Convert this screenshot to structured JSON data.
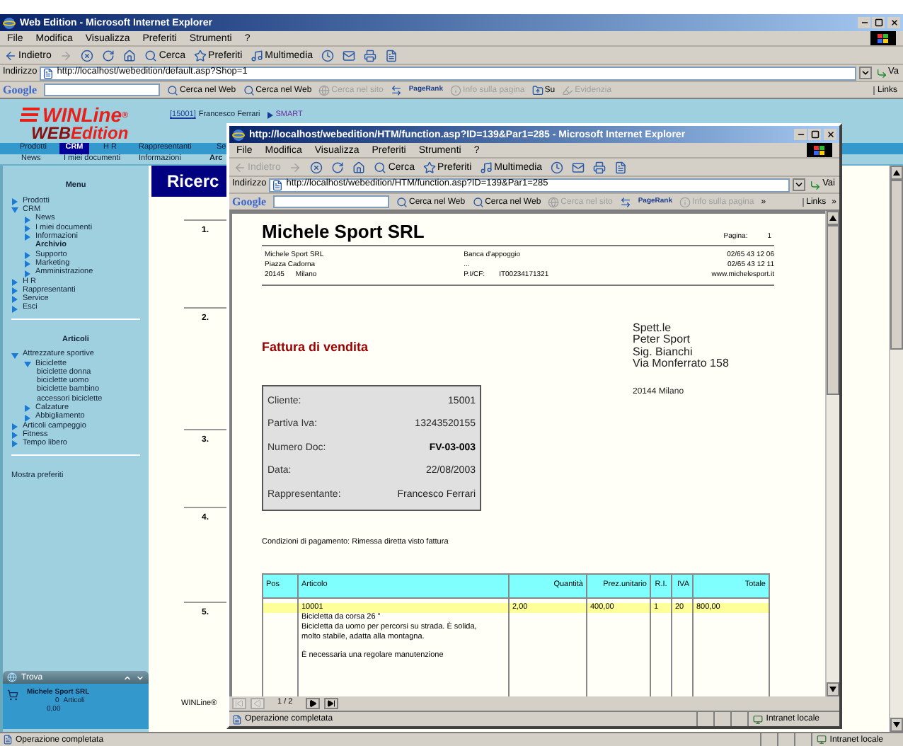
{
  "main": {
    "title": "Web Edition - Microsoft Internet Explorer",
    "menu": [
      "File",
      "Modifica",
      "Visualizza",
      "Preferiti",
      "Strumenti",
      "?"
    ],
    "toolbar": [
      {
        "kind": "back",
        "label": "Indietro",
        "disabled": false
      },
      {
        "kind": "forward",
        "disabled": true
      },
      {
        "kind": "stop",
        "disabled": false
      },
      {
        "kind": "refresh",
        "disabled": false
      },
      {
        "kind": "home",
        "disabled": false
      },
      {
        "kind": "search",
        "label": "Cerca",
        "disabled": false
      },
      {
        "kind": "favorites",
        "label": "Preferiti",
        "disabled": false
      },
      {
        "kind": "media",
        "label": "Multimedia",
        "disabled": false
      },
      {
        "kind": "history",
        "disabled": false
      },
      {
        "kind": "mail",
        "disabled": false
      },
      {
        "kind": "print",
        "disabled": false
      },
      {
        "kind": "edit",
        "disabled": false
      }
    ],
    "address": {
      "label": "Indirizzo",
      "value": "http://localhost/webedition/default.asp?Shop=1",
      "go": "Va"
    },
    "google": {
      "logo": "Google",
      "items": [
        {
          "kind": "search",
          "label": "Cerca nel Web",
          "disabled": false
        },
        {
          "kind": "search",
          "label": "Cerca nel Web",
          "disabled": false
        },
        {
          "kind": "site",
          "label": "Cerca nel sito",
          "disabled": true
        },
        {
          "kind": "arrows",
          "disabled": false
        },
        {
          "kind": "pagerank",
          "label": "PageRank",
          "disabled": false
        },
        {
          "kind": "info",
          "label": "Info sulla pagina",
          "disabled": true
        },
        {
          "kind": "up",
          "label": "Su",
          "disabled": false
        },
        {
          "kind": "highlight",
          "label": "Evidenzia",
          "disabled": true
        }
      ],
      "links": "Links"
    },
    "status": {
      "text": "Operazione completata",
      "zone": "Intranet locale"
    }
  },
  "app": {
    "logo": {
      "name": "WINLine",
      "mark": "®",
      "sub_a": "WEB",
      "sub_b": "Edition"
    },
    "user": {
      "code": "[15001]",
      "name": "Francesco Ferrari",
      "mode": "SMART"
    },
    "nav": [
      {
        "label": "Prodotti",
        "selected": false
      },
      {
        "label": "CRM",
        "selected": true
      },
      {
        "label": "H R",
        "selected": false
      },
      {
        "label": "Rappresentanti",
        "selected": false
      },
      {
        "label": "Se",
        "selected": false
      }
    ],
    "subnav": [
      "News",
      "I miei documenti",
      "Informazioni",
      "Arc"
    ],
    "heading": "Ricerc",
    "menu_title": "Menu",
    "menu": [
      {
        "label": "Prodotti",
        "kind": "node",
        "expanded": false
      },
      {
        "label": "CRM",
        "kind": "node",
        "expanded": true,
        "children": [
          {
            "label": "News",
            "kind": "node",
            "expanded": false
          },
          {
            "label": "I miei documenti",
            "kind": "node",
            "expanded": false
          },
          {
            "label": "Informazioni",
            "kind": "node",
            "expanded": false
          },
          {
            "label": "Archivio",
            "kind": "current"
          },
          {
            "label": "Supporto",
            "kind": "node",
            "expanded": false
          },
          {
            "label": "Marketing",
            "kind": "node",
            "expanded": false
          },
          {
            "label": "Amministrazione",
            "kind": "node",
            "expanded": false
          }
        ]
      },
      {
        "label": "H R",
        "kind": "node",
        "expanded": false
      },
      {
        "label": "Rappresentanti",
        "kind": "node",
        "expanded": false
      },
      {
        "label": "Service",
        "kind": "node",
        "expanded": false
      },
      {
        "label": "Esci",
        "kind": "node",
        "expanded": false
      }
    ],
    "articles_title": "Articoli",
    "articles": [
      {
        "label": "Attrezzature sportive",
        "kind": "node",
        "expanded": true,
        "children": [
          {
            "label": "Biciclette",
            "kind": "node",
            "expanded": true,
            "children": [
              {
                "label": "biciclette donna",
                "kind": "leaf"
              },
              {
                "label": "biciclette uomo",
                "kind": "leaf"
              },
              {
                "label": "biciclette bambino",
                "kind": "leaf"
              },
              {
                "label": "accessori biciclette",
                "kind": "leaf"
              }
            ]
          },
          {
            "label": "Calzature",
            "kind": "node",
            "expanded": false
          },
          {
            "label": "Abbigliamento",
            "kind": "node",
            "expanded": false
          }
        ]
      },
      {
        "label": "Articoli campeggio",
        "kind": "node",
        "expanded": false
      },
      {
        "label": "Fitness",
        "kind": "node",
        "expanded": false
      },
      {
        "label": "Tempo libero",
        "kind": "node",
        "expanded": false
      }
    ],
    "favorites": "Mostra preferiti",
    "rows": [
      "1.",
      "2.",
      "3.",
      "4.",
      "5."
    ],
    "footer": "WINLine®",
    "finder": {
      "title": "Trova",
      "customer": "Michele Sport SRL",
      "count": "0",
      "count_label": "Articoli",
      "amount": "0,00"
    }
  },
  "popup": {
    "title": "http://localhost/webedition/HTM/function.asp?ID=139&Par1=285 - Microsoft Internet Explorer",
    "menu": [
      "File",
      "Modifica",
      "Visualizza",
      "Preferiti",
      "Strumenti",
      "?"
    ],
    "toolbar": [
      {
        "kind": "back",
        "label": "Indietro",
        "disabled": true
      },
      {
        "kind": "forward",
        "disabled": true
      },
      {
        "kind": "stop",
        "disabled": false
      },
      {
        "kind": "refresh",
        "disabled": false
      },
      {
        "kind": "home",
        "disabled": false
      },
      {
        "kind": "search",
        "label": "Cerca",
        "disabled": false
      },
      {
        "kind": "favorites",
        "label": "Preferiti",
        "disabled": false
      },
      {
        "kind": "media",
        "label": "Multimedia",
        "disabled": false
      },
      {
        "kind": "history",
        "disabled": false
      },
      {
        "kind": "mail",
        "disabled": false
      },
      {
        "kind": "print",
        "disabled": false
      },
      {
        "kind": "edit",
        "disabled": false
      }
    ],
    "address": {
      "label": "Indirizzo",
      "value": "http://localhost/webedition/HTM/function.asp?ID=139&Par1=285",
      "go": "Vai"
    },
    "google": {
      "logo": "Google",
      "items": [
        {
          "kind": "search",
          "label": "Cerca nel Web",
          "disabled": false
        },
        {
          "kind": "search",
          "label": "Cerca nel Web",
          "disabled": false
        },
        {
          "kind": "site",
          "label": "Cerca nel sito",
          "disabled": true
        },
        {
          "kind": "arrows",
          "disabled": false
        },
        {
          "kind": "pagerank",
          "label": "PageRank",
          "disabled": false
        },
        {
          "kind": "info",
          "label": "Info sulla pagina",
          "disabled": true
        },
        {
          "kind": "more",
          "label": "»",
          "disabled": false
        }
      ],
      "links": "Links",
      "links_more": "»"
    },
    "document": {
      "company": "Michele Sport SRL",
      "page_label": "Pagina:",
      "page": "1",
      "sender": [
        "Michele Sport SRL",
        "Piazza Cadorna"
      ],
      "zip": "20145",
      "city": "Milano",
      "bank": [
        "Banca d'appoggio",
        "..."
      ],
      "vat_label": "P.I/CF:",
      "vat": "IT00234171321",
      "contacts": [
        "02/65 43 12 06",
        "02/65 43 12 11",
        "www.michelesport.it"
      ],
      "doc_title": "Fattura di vendita",
      "recipient": [
        "Spett.le",
        "Peter Sport",
        "Sig. Bianchi",
        "Via Monferrato 158"
      ],
      "recipient_city": "20144 Milano",
      "info": [
        {
          "label": "Cliente:",
          "value": "15001",
          "bold": false
        },
        {
          "label": "Partiva Iva:",
          "value": "13243520155",
          "bold": false
        },
        {
          "label": "Numero Doc:",
          "value": "FV-03-003",
          "bold": true
        },
        {
          "label": "Data:",
          "value": "22/08/2003",
          "bold": false
        },
        {
          "label": "Rappresentante:",
          "value": "Francesco Ferrari",
          "bold": false
        }
      ],
      "payment": "Condizioni di pagamento: Rimessa diretta visto fattura",
      "table": {
        "columns": [
          "Pos",
          "Articolo",
          "Quantità",
          "Prez.unitario",
          "R.I.",
          "IVA",
          "Totale"
        ],
        "rows": [
          {
            "code": "10001",
            "quantity": "2,00",
            "price": "400,00",
            "ri": "1",
            "iva": "20",
            "total": "800,00",
            "name": "Bicicletta da corsa 26 \"",
            "description": [
              "Bicicletta da uomo per percorsi su strada. È solida, molto stabile, adatta alla montagna.",
              "È necessaria una regolare manutenzione"
            ]
          }
        ]
      }
    },
    "pager": "1 / 2",
    "status": {
      "text": "Operazione completata",
      "zone": "Intranet locale"
    }
  }
}
